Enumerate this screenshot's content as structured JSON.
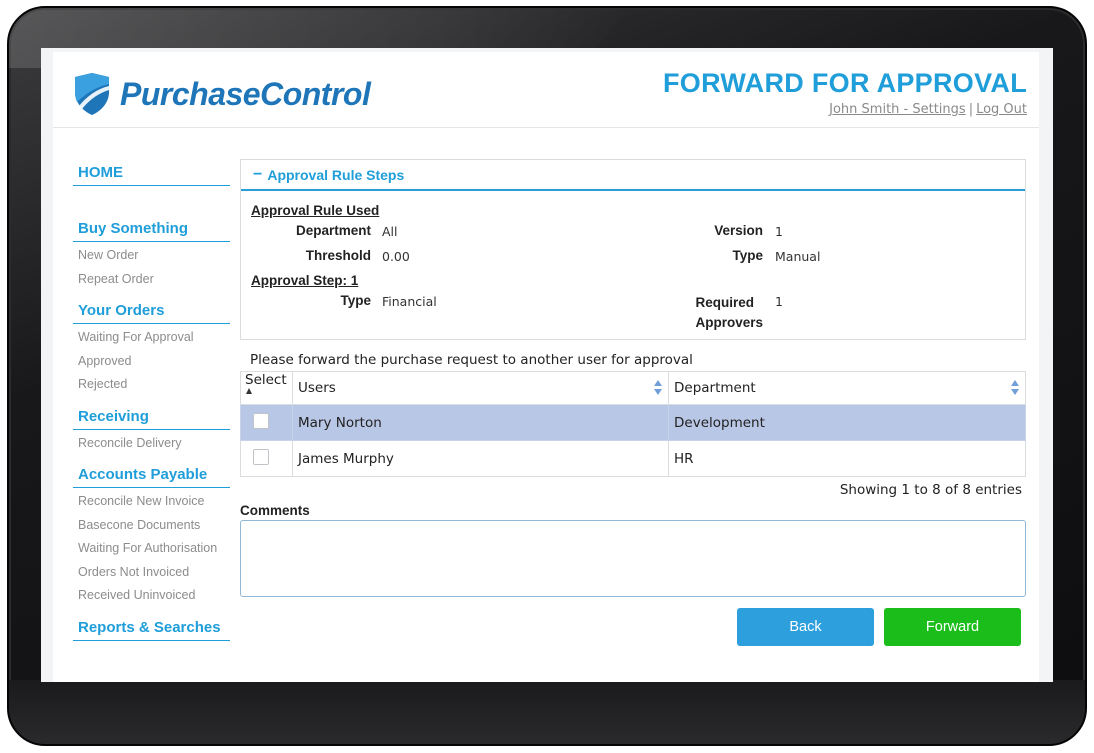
{
  "header": {
    "brand": "PurchaseControl",
    "page_title": "FORWARD FOR APPROVAL",
    "settings_link": "John Smith - Settings",
    "separator": "|",
    "logout_link": "Log Out"
  },
  "sidebar": {
    "home": "HOME",
    "sections": [
      {
        "title": "Buy Something",
        "items": [
          "New Order",
          "Repeat Order"
        ]
      },
      {
        "title": "Your Orders",
        "items": [
          "Waiting For Approval",
          "Approved",
          "Rejected"
        ]
      },
      {
        "title": "Receiving",
        "items": [
          "Reconcile Delivery"
        ]
      },
      {
        "title": "Accounts Payable",
        "items": [
          "Reconcile New Invoice",
          "Basecone Documents",
          "Waiting For Authorisation",
          "Orders Not Invoiced",
          "Received Uninvoiced"
        ]
      },
      {
        "title": "Reports & Searches",
        "items": []
      }
    ]
  },
  "panel": {
    "title": "Approval Rule Steps",
    "collapse_symbol": "−",
    "rule_used_title": "Approval Rule Used",
    "department_label": "Department",
    "department_value": "All",
    "threshold_label": "Threshold",
    "threshold_value": "0.00",
    "version_label": "Version",
    "version_value": "1",
    "type_label": "Type",
    "type_value": "Manual",
    "step_title": "Approval Step: 1",
    "step_type_label": "Type",
    "step_type_value": "Financial",
    "required_label_line1": "Required",
    "required_label_line2": "Approvers",
    "required_value": "1"
  },
  "instruction": "Please forward the purchase request to another user for approval",
  "table": {
    "columns": [
      "Select",
      "Users",
      "Department"
    ],
    "rows": [
      {
        "user": "Mary Norton",
        "department": "Development",
        "selected": true
      },
      {
        "user": "James Murphy",
        "department": "HR",
        "selected": false
      }
    ],
    "entries_text": "Showing 1 to 8 of 8 entries"
  },
  "comments": {
    "label": "Comments",
    "value": ""
  },
  "buttons": {
    "back": "Back",
    "forward": "Forward"
  },
  "colors": {
    "brand_blue": "#1e76b9",
    "accent_blue": "#1f9ed9",
    "back_button": "#2d9fdd",
    "forward_button": "#1bbd1b",
    "selected_row": "#b9c7e6"
  },
  "icons": {
    "logo": "shield-logo-icon",
    "sort": "sort-arrows-icon",
    "collapse": "minus-icon"
  }
}
